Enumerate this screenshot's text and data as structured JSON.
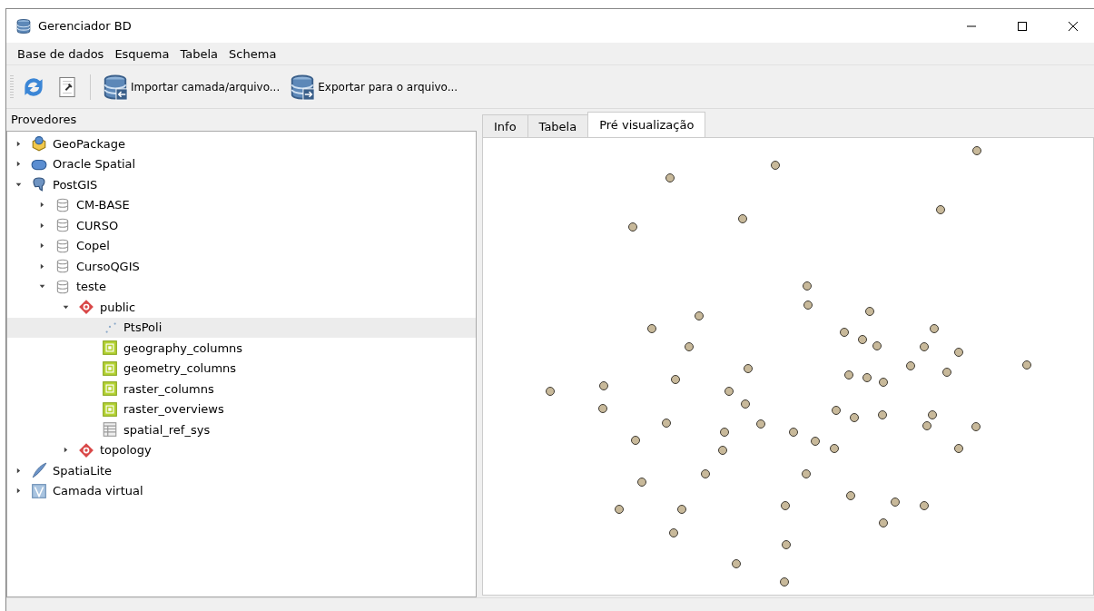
{
  "window": {
    "title": "Gerenciador BD"
  },
  "menu": [
    {
      "label": "Base de dados"
    },
    {
      "label": "Esquema"
    },
    {
      "label": "Tabela"
    },
    {
      "label": "Schema"
    }
  ],
  "toolbar": [
    {
      "kind": "refresh"
    },
    {
      "kind": "sql"
    },
    {
      "kind": "import",
      "label": "Importar camada/arquivo..."
    },
    {
      "kind": "export",
      "label": "Exportar para o arquivo..."
    }
  ],
  "providers": {
    "title": "Provedores",
    "items": [
      {
        "label": "GeoPackage",
        "kind": "geopackage",
        "expanded": false,
        "selected": false
      },
      {
        "label": "Oracle Spatial",
        "kind": "oracle",
        "expanded": false,
        "selected": false
      },
      {
        "label": "PostGIS",
        "kind": "postgis",
        "expanded": true,
        "selected": false,
        "children": [
          {
            "label": "CM-BASE",
            "kind": "database",
            "expanded": false,
            "selected": false
          },
          {
            "label": "CURSO",
            "kind": "database",
            "expanded": false,
            "selected": false
          },
          {
            "label": "Copel",
            "kind": "database",
            "expanded": false,
            "selected": false
          },
          {
            "label": "CursoQGIS",
            "kind": "database",
            "expanded": false,
            "selected": false
          },
          {
            "label": "teste",
            "kind": "database",
            "expanded": true,
            "selected": false,
            "children": [
              {
                "label": "public",
                "kind": "schema",
                "expanded": true,
                "selected": false,
                "children": [
                  {
                    "label": "PtsPoli",
                    "kind": "points",
                    "selected": true
                  },
                  {
                    "label": "geography_columns",
                    "kind": "view",
                    "selected": false
                  },
                  {
                    "label": "geometry_columns",
                    "kind": "view",
                    "selected": false
                  },
                  {
                    "label": "raster_columns",
                    "kind": "view",
                    "selected": false
                  },
                  {
                    "label": "raster_overviews",
                    "kind": "view",
                    "selected": false
                  },
                  {
                    "label": "spatial_ref_sys",
                    "kind": "table",
                    "selected": false
                  }
                ]
              },
              {
                "label": "topology",
                "kind": "schema",
                "expanded": false,
                "selected": false
              }
            ]
          }
        ]
      },
      {
        "label": "SpatiaLite",
        "kind": "spatialite",
        "expanded": false,
        "selected": false
      },
      {
        "label": "Camada virtual",
        "kind": "virtual",
        "expanded": false,
        "selected": false
      }
    ]
  },
  "tabs": [
    {
      "label": "Info",
      "selected": false
    },
    {
      "label": "Tabela",
      "selected": false
    },
    {
      "label": "Pré visualização",
      "selected": true
    }
  ]
}
